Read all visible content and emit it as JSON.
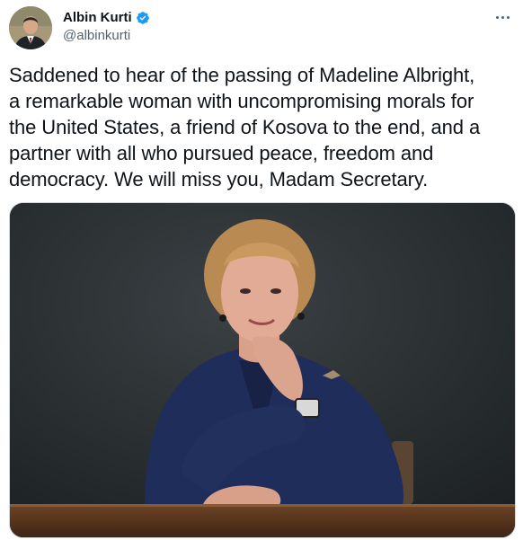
{
  "author": {
    "display_name": "Albin Kurti",
    "handle": "@albinkurti",
    "verified": true,
    "avatar_icon": "profile-photo",
    "verified_icon": "verified-badge-icon",
    "verified_color": "#1d9bf0"
  },
  "more_icon": "more-options-icon",
  "tweet": {
    "text": "Saddened to hear of the passing of Madeline Albright,\na remarkable woman with uncompromising morals for\nthe United States, a friend of Kosova to the end, and a\npartner with all who pursued peace, freedom and\ndemocracy. We will miss you, Madam Secretary."
  },
  "media": {
    "type": "photo",
    "icon": "portrait-photo"
  },
  "colors": {
    "text": "#0f1419",
    "secondary_text": "#536471",
    "border": "#cfd9de"
  }
}
